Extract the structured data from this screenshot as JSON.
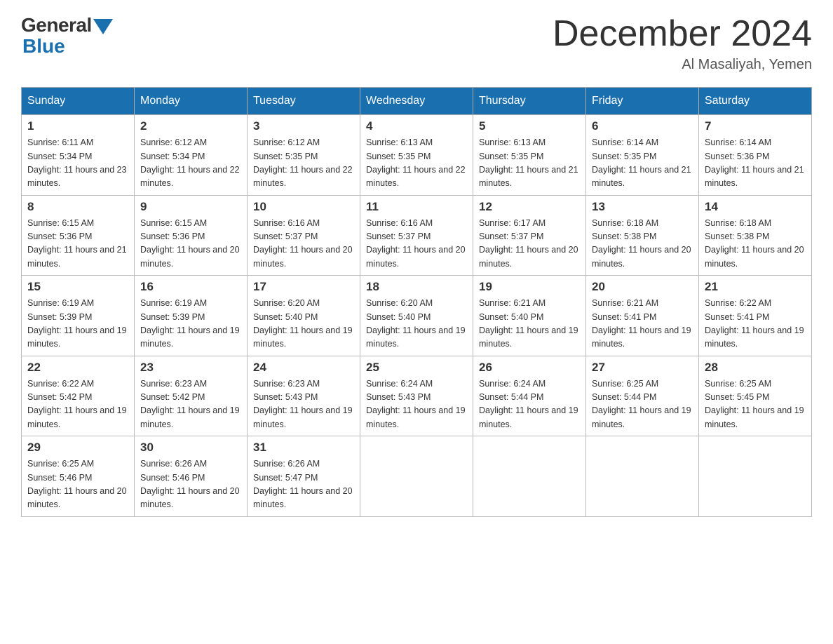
{
  "header": {
    "logo": {
      "general": "General",
      "blue": "Blue"
    },
    "title": "December 2024",
    "subtitle": "Al Masaliyah, Yemen"
  },
  "weekdays": [
    "Sunday",
    "Monday",
    "Tuesday",
    "Wednesday",
    "Thursday",
    "Friday",
    "Saturday"
  ],
  "weeks": [
    [
      {
        "day": "1",
        "sunrise": "6:11 AM",
        "sunset": "5:34 PM",
        "daylight": "11 hours and 23 minutes."
      },
      {
        "day": "2",
        "sunrise": "6:12 AM",
        "sunset": "5:34 PM",
        "daylight": "11 hours and 22 minutes."
      },
      {
        "day": "3",
        "sunrise": "6:12 AM",
        "sunset": "5:35 PM",
        "daylight": "11 hours and 22 minutes."
      },
      {
        "day": "4",
        "sunrise": "6:13 AM",
        "sunset": "5:35 PM",
        "daylight": "11 hours and 22 minutes."
      },
      {
        "day": "5",
        "sunrise": "6:13 AM",
        "sunset": "5:35 PM",
        "daylight": "11 hours and 21 minutes."
      },
      {
        "day": "6",
        "sunrise": "6:14 AM",
        "sunset": "5:35 PM",
        "daylight": "11 hours and 21 minutes."
      },
      {
        "day": "7",
        "sunrise": "6:14 AM",
        "sunset": "5:36 PM",
        "daylight": "11 hours and 21 minutes."
      }
    ],
    [
      {
        "day": "8",
        "sunrise": "6:15 AM",
        "sunset": "5:36 PM",
        "daylight": "11 hours and 21 minutes."
      },
      {
        "day": "9",
        "sunrise": "6:15 AM",
        "sunset": "5:36 PM",
        "daylight": "11 hours and 20 minutes."
      },
      {
        "day": "10",
        "sunrise": "6:16 AM",
        "sunset": "5:37 PM",
        "daylight": "11 hours and 20 minutes."
      },
      {
        "day": "11",
        "sunrise": "6:16 AM",
        "sunset": "5:37 PM",
        "daylight": "11 hours and 20 minutes."
      },
      {
        "day": "12",
        "sunrise": "6:17 AM",
        "sunset": "5:37 PM",
        "daylight": "11 hours and 20 minutes."
      },
      {
        "day": "13",
        "sunrise": "6:18 AM",
        "sunset": "5:38 PM",
        "daylight": "11 hours and 20 minutes."
      },
      {
        "day": "14",
        "sunrise": "6:18 AM",
        "sunset": "5:38 PM",
        "daylight": "11 hours and 20 minutes."
      }
    ],
    [
      {
        "day": "15",
        "sunrise": "6:19 AM",
        "sunset": "5:39 PM",
        "daylight": "11 hours and 19 minutes."
      },
      {
        "day": "16",
        "sunrise": "6:19 AM",
        "sunset": "5:39 PM",
        "daylight": "11 hours and 19 minutes."
      },
      {
        "day": "17",
        "sunrise": "6:20 AM",
        "sunset": "5:40 PM",
        "daylight": "11 hours and 19 minutes."
      },
      {
        "day": "18",
        "sunrise": "6:20 AM",
        "sunset": "5:40 PM",
        "daylight": "11 hours and 19 minutes."
      },
      {
        "day": "19",
        "sunrise": "6:21 AM",
        "sunset": "5:40 PM",
        "daylight": "11 hours and 19 minutes."
      },
      {
        "day": "20",
        "sunrise": "6:21 AM",
        "sunset": "5:41 PM",
        "daylight": "11 hours and 19 minutes."
      },
      {
        "day": "21",
        "sunrise": "6:22 AM",
        "sunset": "5:41 PM",
        "daylight": "11 hours and 19 minutes."
      }
    ],
    [
      {
        "day": "22",
        "sunrise": "6:22 AM",
        "sunset": "5:42 PM",
        "daylight": "11 hours and 19 minutes."
      },
      {
        "day": "23",
        "sunrise": "6:23 AM",
        "sunset": "5:42 PM",
        "daylight": "11 hours and 19 minutes."
      },
      {
        "day": "24",
        "sunrise": "6:23 AM",
        "sunset": "5:43 PM",
        "daylight": "11 hours and 19 minutes."
      },
      {
        "day": "25",
        "sunrise": "6:24 AM",
        "sunset": "5:43 PM",
        "daylight": "11 hours and 19 minutes."
      },
      {
        "day": "26",
        "sunrise": "6:24 AM",
        "sunset": "5:44 PM",
        "daylight": "11 hours and 19 minutes."
      },
      {
        "day": "27",
        "sunrise": "6:25 AM",
        "sunset": "5:44 PM",
        "daylight": "11 hours and 19 minutes."
      },
      {
        "day": "28",
        "sunrise": "6:25 AM",
        "sunset": "5:45 PM",
        "daylight": "11 hours and 19 minutes."
      }
    ],
    [
      {
        "day": "29",
        "sunrise": "6:25 AM",
        "sunset": "5:46 PM",
        "daylight": "11 hours and 20 minutes."
      },
      {
        "day": "30",
        "sunrise": "6:26 AM",
        "sunset": "5:46 PM",
        "daylight": "11 hours and 20 minutes."
      },
      {
        "day": "31",
        "sunrise": "6:26 AM",
        "sunset": "5:47 PM",
        "daylight": "11 hours and 20 minutes."
      },
      null,
      null,
      null,
      null
    ]
  ]
}
